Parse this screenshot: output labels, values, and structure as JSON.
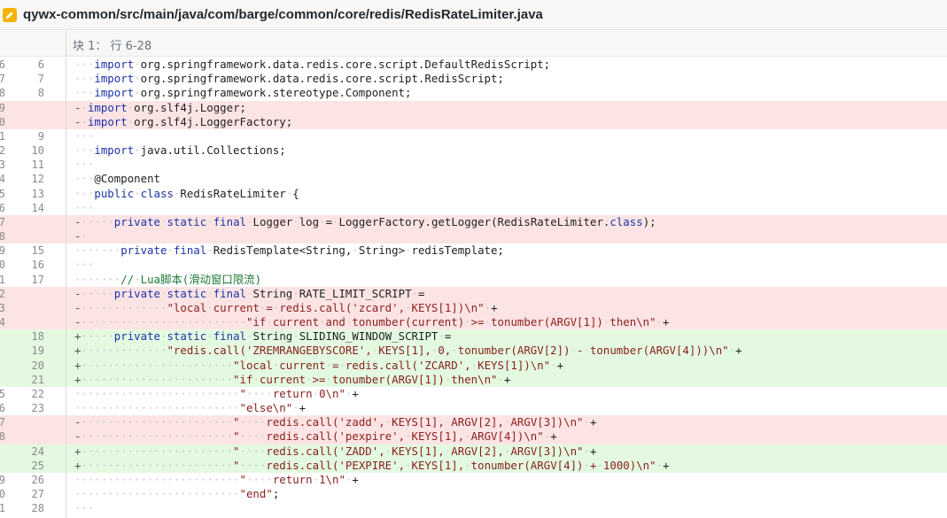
{
  "header": {
    "file_path": "qywx-common/src/main/java/com/barge/common/core/redis/RedisRateLimiter.java",
    "icon": "pencil-edit-icon",
    "icon_color": "#f5b400"
  },
  "hunk": {
    "label": "块 1： 行 6-28"
  },
  "colors": {
    "deleted_bg": "#fde4e4",
    "added_bg": "#e3fae1"
  },
  "lines": [
    {
      "type": "ctx",
      "old": "6",
      "new": "6",
      "text": "···import·org.springframework.data.redis.core.script.DefaultRedisScript;"
    },
    {
      "type": "ctx",
      "old": "7",
      "new": "7",
      "text": "···import·org.springframework.data.redis.core.script.RedisScript;"
    },
    {
      "type": "ctx",
      "old": "8",
      "new": "8",
      "text": "···import·org.springframework.stereotype.Component;"
    },
    {
      "type": "del",
      "old": "9",
      "new": "",
      "text": "-·import·org.slf4j.Logger;"
    },
    {
      "type": "del",
      "old": "10",
      "new": "",
      "text": "-·import·org.slf4j.LoggerFactory;"
    },
    {
      "type": "ctx",
      "old": "11",
      "new": "9",
      "text": "···"
    },
    {
      "type": "ctx",
      "old": "12",
      "new": "10",
      "text": "···import·java.util.Collections;"
    },
    {
      "type": "ctx",
      "old": "13",
      "new": "11",
      "text": "···"
    },
    {
      "type": "ctx",
      "old": "14",
      "new": "12",
      "text": "···@Component"
    },
    {
      "type": "ctx",
      "old": "15",
      "new": "13",
      "text": "···public·class·RedisRateLimiter·{"
    },
    {
      "type": "ctx",
      "old": "16",
      "new": "14",
      "text": "···"
    },
    {
      "type": "del",
      "old": "17",
      "new": "",
      "text": "-·····private·static·final·Logger·log·=·LoggerFactory.getLogger(RedisRateLimiter.class);"
    },
    {
      "type": "del",
      "old": "18",
      "new": "",
      "text": "-·"
    },
    {
      "type": "ctx",
      "old": "19",
      "new": "15",
      "text": "·······private·final·RedisTemplate<String,·String>·redisTemplate;"
    },
    {
      "type": "ctx",
      "old": "20",
      "new": "16",
      "text": "···"
    },
    {
      "type": "ctx",
      "old": "21",
      "new": "17",
      "text": "·······//·Lua脚本(滑动窗口限流)"
    },
    {
      "type": "del",
      "old": "22",
      "new": "",
      "text": "-·····private·static·final·String·RATE_LIMIT_SCRIPT·="
    },
    {
      "type": "del",
      "old": "23",
      "new": "",
      "text": "-·············\"local·current·=·redis.call('zcard',·KEYS[1])\\n\"·+"
    },
    {
      "type": "del",
      "old": "24",
      "new": "",
      "text": "-·························\"if·current·and·tonumber(current)·>=·tonumber(ARGV[1])·then\\n\"·+"
    },
    {
      "type": "add",
      "old": "",
      "new": "18",
      "text": "+·····private·static·final·String·SLIDING_WINDOW_SCRIPT·="
    },
    {
      "type": "add",
      "old": "",
      "new": "19",
      "text": "+·············\"redis.call('ZREMRANGEBYSCORE',·KEYS[1],·0,·tonumber(ARGV[2])·-·tonumber(ARGV[4]))\\n\"·+"
    },
    {
      "type": "add",
      "old": "",
      "new": "20",
      "text": "+·······················\"local·current·=·redis.call('ZCARD',·KEYS[1])\\n\"·+"
    },
    {
      "type": "add",
      "old": "",
      "new": "21",
      "text": "+·······················\"if·current·>=·tonumber(ARGV[1])·then\\n\"·+"
    },
    {
      "type": "ctx",
      "old": "25",
      "new": "22",
      "text": "·························\"····return·0\\n\"·+"
    },
    {
      "type": "ctx",
      "old": "26",
      "new": "23",
      "text": "·························\"else\\n\"·+"
    },
    {
      "type": "del",
      "old": "27",
      "new": "",
      "text": "-·······················\"····redis.call('zadd',·KEYS[1],·ARGV[2],·ARGV[3])\\n\"·+"
    },
    {
      "type": "del",
      "old": "28",
      "new": "",
      "text": "-·······················\"····redis.call('pexpire',·KEYS[1],·ARGV[4])\\n\"·+"
    },
    {
      "type": "add",
      "old": "",
      "new": "24",
      "text": "+·······················\"····redis.call('ZADD',·KEYS[1],·ARGV[2],·ARGV[3])\\n\"·+"
    },
    {
      "type": "add",
      "old": "",
      "new": "25",
      "text": "+·······················\"····redis.call('PEXPIRE',·KEYS[1],·tonumber(ARGV[4])·+·1000)\\n\"·+"
    },
    {
      "type": "ctx",
      "old": "29",
      "new": "26",
      "text": "·························\"····return·1\\n\"·+"
    },
    {
      "type": "ctx",
      "old": "30",
      "new": "27",
      "text": "·························\"end\";"
    },
    {
      "type": "ctx",
      "old": "31",
      "new": "28",
      "text": "···"
    }
  ]
}
